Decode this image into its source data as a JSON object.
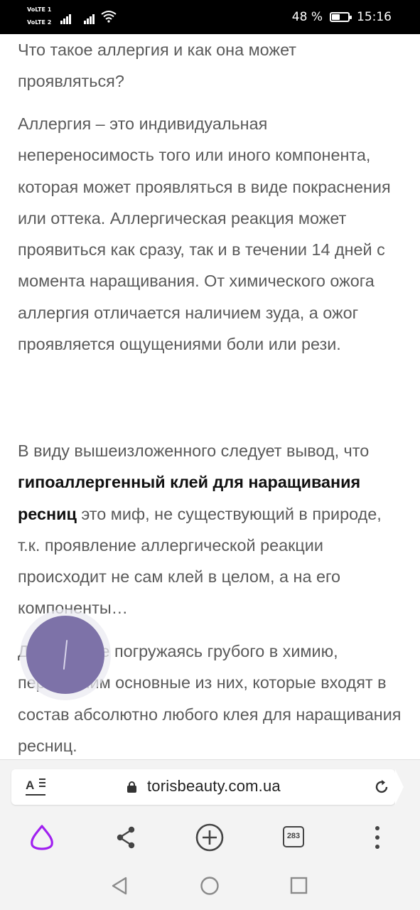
{
  "status_bar": {
    "volte1": "VoLTE 1",
    "volte2": "VoLTE 2",
    "battery_percent": "48 %",
    "battery_level": 0.48,
    "time": "15:16"
  },
  "article": {
    "p1": "Что такое аллергия и как она может проявляться?",
    "p2": "Аллергия – это индивидуальная непереносимость того или иного компонента, которая может проявляться в виде покраснения или оттека. Аллергическая реакция может проявиться как сразу, так и в течении 14 дней с момента наращивания.  От химического ожога аллергия отличается наличием зуда, а ожог проявляется  ощущениями боли или рези.",
    "p3_before": "В виду вышеизложенного следует вывод, что ",
    "p3_bold": "гипоаллергенный клей для наращивания ресниц ",
    "p3_after": " это миф, не существующий в природе, т.к. проявление аллергической реакции  происходит не сам клей в целом, а на его компоненты…",
    "p4": "Давайте, не погружаясь грубого в химию, перечислим основные из них, которые входят  в состав абсолютно любого клея для наращивания ресниц."
  },
  "browser": {
    "url": "torisbeauty.com.ua",
    "tab_count": "283"
  },
  "icons": {
    "reader": "reader-mode-icon",
    "lock": "lock-icon",
    "refresh": "refresh-icon",
    "alice": "alice-assistant-icon",
    "share": "share-icon",
    "new_tab": "plus-circle-icon",
    "tabs": "tabs-counter-icon",
    "menu": "more-vertical-icon",
    "back": "back-triangle-icon",
    "home": "home-circle-icon",
    "recents": "recents-square-icon"
  },
  "colors": {
    "alice_purple": "#a020f0",
    "fab_purple": "#7d72a8",
    "body_text": "#5a5a5a"
  }
}
